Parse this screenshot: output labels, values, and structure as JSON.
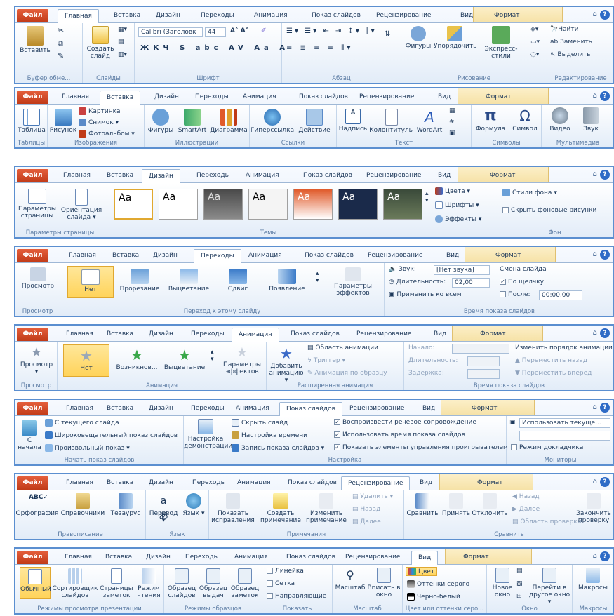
{
  "file_label": "Файл",
  "format_label": "Формат",
  "help_min": "⌂",
  "help_q": "?",
  "tab_labels": [
    "Главная",
    "Вставка",
    "Дизайн",
    "Переходы",
    "Анимация",
    "Показ слайдов",
    "Рецензирование",
    "Вид"
  ],
  "home": {
    "paste": "Вставить",
    "new_slide": "Создать слайд",
    "font_name": "Calibri (Заголовк",
    "font_size": "44",
    "shapes": "Фигуры",
    "arrange": "Упорядочить",
    "quick_styles": "Экспресс-стили",
    "find": "Найти",
    "replace": "Заменить",
    "select": "Выделить",
    "groups": [
      "Буфер обме...",
      "Слайды",
      "Шрифт",
      "Абзац",
      "Рисование",
      "Редактирование"
    ]
  },
  "insert": {
    "table": "Таблица",
    "picture": "Рисунок",
    "clip": "Картинка",
    "screenshot": "Снимок",
    "album": "Фотоальбом",
    "shapes": "Фигуры",
    "smartart": "SmartArt",
    "chart": "Диаграмма",
    "hyperlink": "Гиперссылка",
    "action": "Действие",
    "textbox": "Надпись",
    "header": "Колонтитулы",
    "wordart": "WordArt",
    "equation": "Формула",
    "symbol": "Символ",
    "video": "Видео",
    "audio": "Звук",
    "groups": [
      "Таблицы",
      "Изображения",
      "Иллюстрации",
      "Ссылки",
      "Текст",
      "Символы",
      "Мультимедиа"
    ]
  },
  "design": {
    "page_setup": "Параметры страницы",
    "orientation": "Ориентация слайда",
    "aa": "Aa",
    "colors": "Цвета",
    "fonts": "Шрифты",
    "effects": "Эффекты",
    "bg_styles": "Стили фона",
    "hide_bg": "Скрыть фоновые рисунки",
    "groups": [
      "Параметры страницы",
      "Темы",
      "Фон"
    ]
  },
  "transitions": {
    "preview": "Просмотр",
    "none": "Нет",
    "cut": "Прорезание",
    "fade": "Выцветание",
    "push": "Сдвиг",
    "reveal": "Появление",
    "effect_opts": "Параметры эффектов",
    "sound_label": "Звук:",
    "sound_val": "[Нет звука]",
    "duration_label": "Длительность:",
    "duration_val": "02,00",
    "apply_all": "Применить ко всем",
    "advance": "Смена слайда",
    "on_click": "По щелчку",
    "after": "После:",
    "after_val": "00:00,00",
    "groups": [
      "Просмотр",
      "Переход к этому слайду",
      "Время показа слайдов"
    ]
  },
  "animation": {
    "preview": "Просмотр",
    "none": "Нет",
    "appear": "Возникнов...",
    "fade": "Выцветание",
    "effect_opts": "Параметры эффектов",
    "add_anim": "Добавить анимацию",
    "pane": "Область анимации",
    "trigger": "Триггер",
    "painter": "Анимация по образцу",
    "start": "Начало:",
    "duration": "Длительность:",
    "delay": "Задержка:",
    "reorder": "Изменить порядок анимации",
    "move_back": "Переместить назад",
    "move_fwd": "Переместить вперед",
    "groups": [
      "Просмотр",
      "Анимация",
      "Расширенная анимация",
      "Время показа слайдов"
    ]
  },
  "slideshow": {
    "from_begin": "С начала",
    "from_current": "С текущего слайда",
    "broadcast": "Широковещательный показ слайдов",
    "custom": "Произвольный показ",
    "setup": "Настройка демонстрации",
    "hide": "Скрыть слайд",
    "rehearse": "Настройка времени",
    "record": "Запись показа слайдов",
    "narr": "Воспроизвести речевое сопровождение",
    "timings": "Использовать время показа слайдов",
    "controls": "Показать элементы управления проигрывателем",
    "monitor_val": "Использовать текуще...",
    "presenter": "Режим докладчика",
    "groups": [
      "Начать показ слайдов",
      "Настройка",
      "Мониторы"
    ]
  },
  "review": {
    "spelling": "Орфография",
    "research": "Справочники",
    "thesaurus": "Тезаурус",
    "translate": "Перевод",
    "language": "Язык",
    "show_markup": "Показать исправления",
    "new_comment": "Создать примечание",
    "edit_comment": "Изменить примечание",
    "delete": "Удалить",
    "prev": "Назад",
    "next": "Далее",
    "compare": "Сравнить",
    "accept": "Принять",
    "reject": "Отклонить",
    "prev2": "Назад",
    "next2": "Далее",
    "pane": "Область проверки",
    "end": "Закончить проверку",
    "groups": [
      "Правописание",
      "Язык",
      "Примечания",
      "Сравнить"
    ]
  },
  "view": {
    "normal": "Обычный",
    "sorter": "Сортировщик слайдов",
    "notes": "Страницы заметок",
    "reading": "Режим чтения",
    "master_slide": "Образец слайдов",
    "master_handout": "Образец выдач",
    "master_notes": "Образец заметок",
    "ruler": "Линейка",
    "grid": "Сетка",
    "guides": "Направляющие",
    "zoom": "Масштаб",
    "fit": "Вписать в окно",
    "color": "Цвет",
    "gray": "Оттенки серого",
    "bw": "Черно-белый",
    "new_window": "Новое окно",
    "switch": "Перейти в другое окно",
    "macros": "Макросы",
    "groups": [
      "Режимы просмотра презентации",
      "Режимы образцов",
      "Показать",
      "Масштаб",
      "Цвет или оттенки серо...",
      "Окно",
      "Макросы"
    ]
  }
}
